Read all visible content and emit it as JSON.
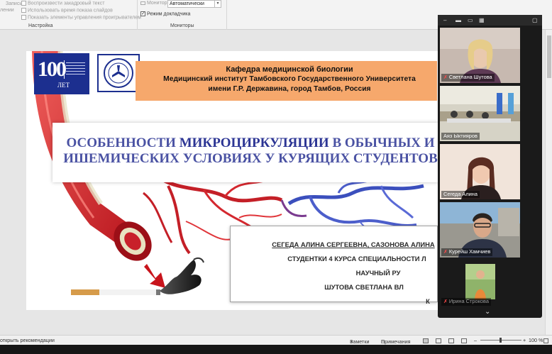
{
  "ribbon": {
    "left_stub_1": "Запись",
    "left_stub_2": "лении",
    "items_col1": [
      "Воспроизвести закадровый текст",
      "Использовать время показа слайдов",
      "Показать элементы управления проигрывателем"
    ],
    "group_setup_label": "Настройка",
    "monitor_label": "Монитор",
    "monitor_value": "Автоматически",
    "presenter_view_label": "Режим докладчика",
    "group_monitors_label": "Мониторы"
  },
  "slide": {
    "logo_number": "100",
    "logo_sub": "ЛЕТ",
    "header": [
      "Кафедра медицинской биологии",
      "Медицинский институт Тамбовского Государственного Университета",
      "имени Г.Р. Державина, город Тамбов, Россия"
    ],
    "title_line1_a": "ОСОБЕННОСТИ ",
    "title_line1_b": "МИКРОЦИРКУЛЯЦИИ",
    "title_line1_c": " В ОБЫЧНЫХ И",
    "title_line2": "ИШЕМИЧЕСКИХ УСЛОВИЯХ У КУРЯЩИХ СТУДЕНТОВ",
    "authors": [
      "СЕГЕДА АЛИНА СЕРГЕЕВНА, САЗОНОВА АЛИНА",
      "СТУДЕНТКИ 4 КУРСА СПЕЦИАЛЬНОСТИ Л",
      "НАУЧНЫЙ РУ",
      "ШУТОВА СВЕТЛАНА ВЛ",
      "К"
    ]
  },
  "zoom": {
    "participants": [
      {
        "name": "Светлана Шутова",
        "muted": true
      },
      {
        "name": "Аяз Ыктияров",
        "muted": false
      },
      {
        "name": "Сегеда Алина",
        "muted": false
      },
      {
        "name": "Курейш Хамчиев",
        "muted": true
      },
      {
        "name": "Ирина Строкова",
        "muted": true
      }
    ],
    "chevron": "⌄"
  },
  "statusbar": {
    "left_text": "открыть рекомендации",
    "notes_label": "Заметки",
    "comments_label": "Примечания",
    "zoom_minus": "–",
    "zoom_plus": "+",
    "zoom_level": "100 %"
  },
  "colors": {
    "ribbon_bg": "#f3f3f3",
    "header_orange": "#f6a86c",
    "title_blue": "#4a52a3",
    "logo_blue": "#1c2f8f",
    "zoom_dark": "#1a1a1a"
  }
}
